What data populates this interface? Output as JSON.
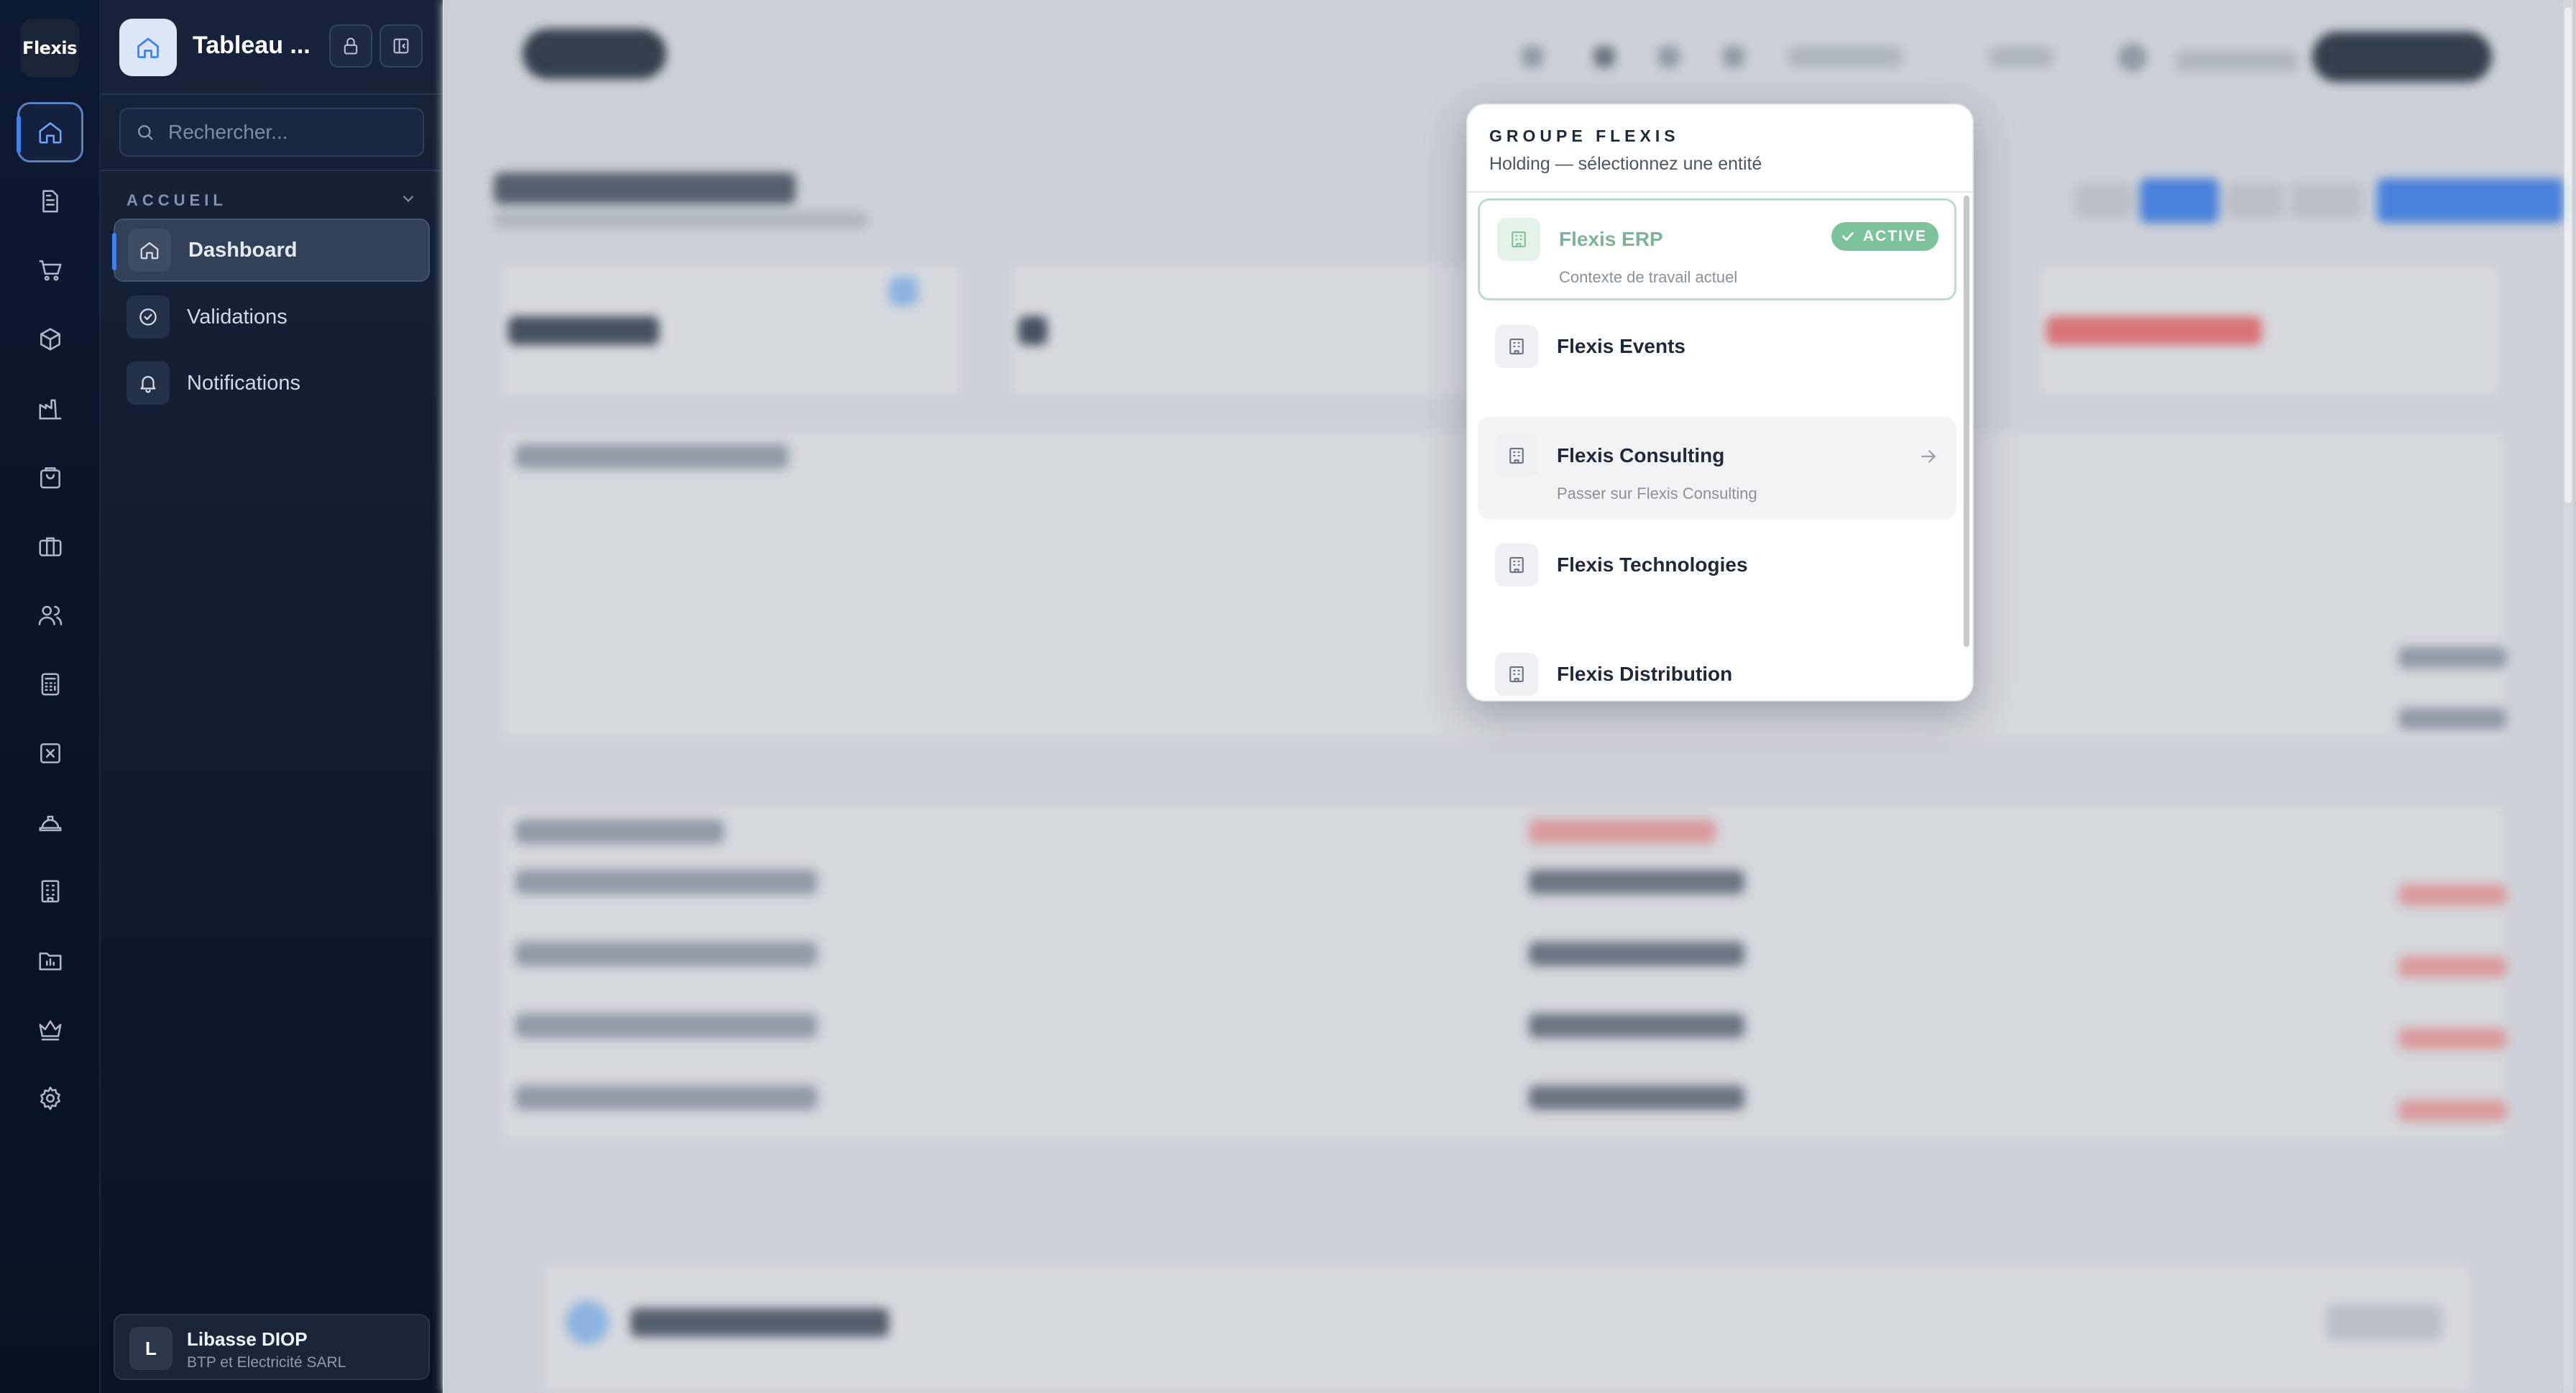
{
  "rail": {
    "logo": "Flexis",
    "items": [
      "home-icon",
      "document-icon",
      "cart-icon",
      "box-icon",
      "factory-icon",
      "bag-icon",
      "briefcase-icon",
      "users-icon",
      "calculator-icon",
      "close-square-icon",
      "hardhat-icon",
      "building-icon",
      "folder-icon",
      "crown-icon",
      "gear-icon"
    ]
  },
  "sidebar": {
    "title": "Tableau ...",
    "search_placeholder": "Rechercher...",
    "section": "ACCUEIL",
    "items": [
      {
        "label": "Dashboard",
        "icon": "home-icon",
        "active": true
      },
      {
        "label": "Validations",
        "icon": "check-circle-icon",
        "active": false
      },
      {
        "label": "Notifications",
        "icon": "bell-icon",
        "active": false
      }
    ],
    "user": {
      "initial": "L",
      "name": "Libasse DIOP",
      "company": "BTP et Electricité SARL"
    }
  },
  "popup": {
    "title": "GROUPE FLEXIS",
    "subtitle": "Holding — sélectionnez une entité",
    "entities": [
      {
        "name": "Flexis ERP",
        "desc": "Contexte de travail actuel",
        "badge": "ACTIVE",
        "state": "active"
      },
      {
        "name": "Flexis Events",
        "desc": "",
        "state": "normal"
      },
      {
        "name": "Flexis Consulting",
        "desc": "Passer sur Flexis Consulting",
        "state": "hover"
      },
      {
        "name": "Flexis Technologies",
        "desc": "",
        "state": "normal"
      },
      {
        "name": "Flexis Distribution",
        "desc": "",
        "state": "normal"
      }
    ]
  },
  "colors": {
    "accent": "#3b82f6",
    "active_green": "#7cc39d",
    "sidebar_bg": "#111c30"
  }
}
